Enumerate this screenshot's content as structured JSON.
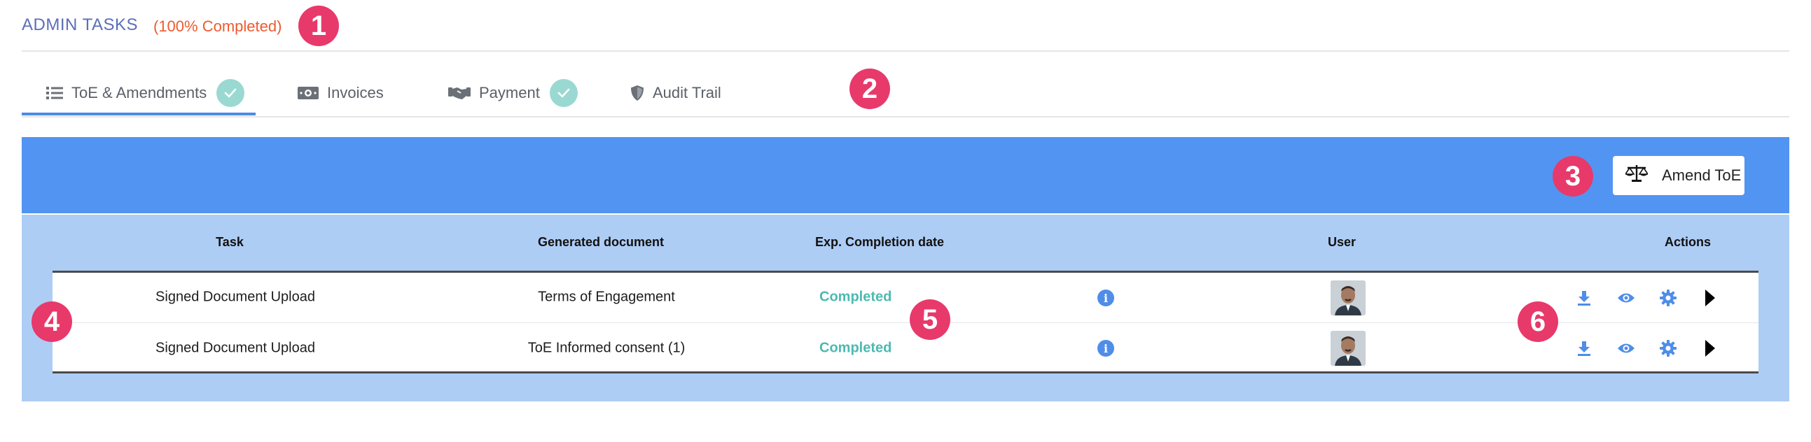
{
  "header": {
    "title": "ADMIN TASKS",
    "progress": "(100% Completed)"
  },
  "tabs": [
    {
      "label": "ToE & Amendments",
      "icon": "list-icon",
      "completed": true,
      "active": true
    },
    {
      "label": "Invoices",
      "icon": "money-bill-icon",
      "completed": false,
      "active": false
    },
    {
      "label": "Payment",
      "icon": "handshake-icon",
      "completed": true,
      "active": false
    },
    {
      "label": "Audit Trail",
      "icon": "shield-icon",
      "completed": false,
      "active": false
    }
  ],
  "toolbar": {
    "amend_label": "Amend ToE",
    "amend_icon": "scales-icon"
  },
  "table": {
    "headers": {
      "task": "Task",
      "document": "Generated document",
      "completion": "Exp. Completion date",
      "user": "User",
      "actions": "Actions"
    },
    "rows": [
      {
        "task": "Signed Document Upload",
        "document": "Terms of Engagement",
        "status": "Completed"
      },
      {
        "task": "Signed Document Upload",
        "document": "ToE Informed consent (1)",
        "status": "Completed"
      }
    ]
  },
  "actions": [
    "download-icon",
    "eye-icon",
    "gear-icon",
    "play-icon"
  ],
  "markers": [
    "1",
    "2",
    "3",
    "4",
    "5",
    "6"
  ],
  "colors": {
    "accent": "#5294f2",
    "table_bg": "#aecdf5",
    "tab_active": "#4a8be6",
    "completed": "#4cbab0",
    "progress": "#ee5a2e",
    "marker": "#e8396b",
    "check": "#9ad9d2"
  }
}
